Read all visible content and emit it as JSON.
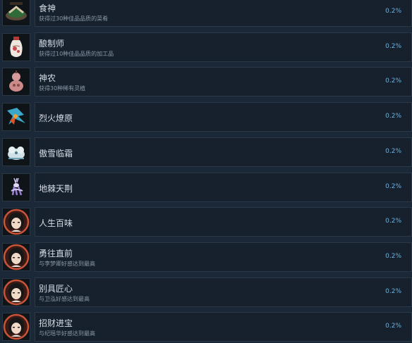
{
  "achievements": [
    {
      "title": "食神",
      "description": "获得过30种佳品品质的菜肴",
      "percent": "0.2%",
      "icon": "dish-icon"
    },
    {
      "title": "酿制师",
      "description": "获得过10种佳品品质的加工品",
      "percent": "0.2%",
      "icon": "wine-jar-icon"
    },
    {
      "title": "神农",
      "description": "获得30种稀有灵植",
      "percent": "0.2%",
      "icon": "gourd-icon"
    },
    {
      "title": "烈火燎原",
      "description": "",
      "percent": "0.2%",
      "icon": "fire-bird-icon"
    },
    {
      "title": "傲雪临霜",
      "description": "",
      "percent": "0.2%",
      "icon": "frost-beast-icon"
    },
    {
      "title": "地棘天荆",
      "description": "",
      "percent": "0.2%",
      "icon": "deer-spirit-icon"
    },
    {
      "title": "人生百味",
      "description": "",
      "percent": "0.2%",
      "icon": "character-portrait-icon"
    },
    {
      "title": "勇往直前",
      "description": "与李梦卿好感达到最高",
      "percent": "0.2%",
      "icon": "character-portrait-icon"
    },
    {
      "title": "别具匠心",
      "description": "与卫泓好感达到最高",
      "percent": "0.2%",
      "icon": "character-portrait-icon"
    },
    {
      "title": "招财进宝",
      "description": "与纪瑶华好感达到最高",
      "percent": "0.2%",
      "icon": "character-portrait-icon"
    }
  ]
}
